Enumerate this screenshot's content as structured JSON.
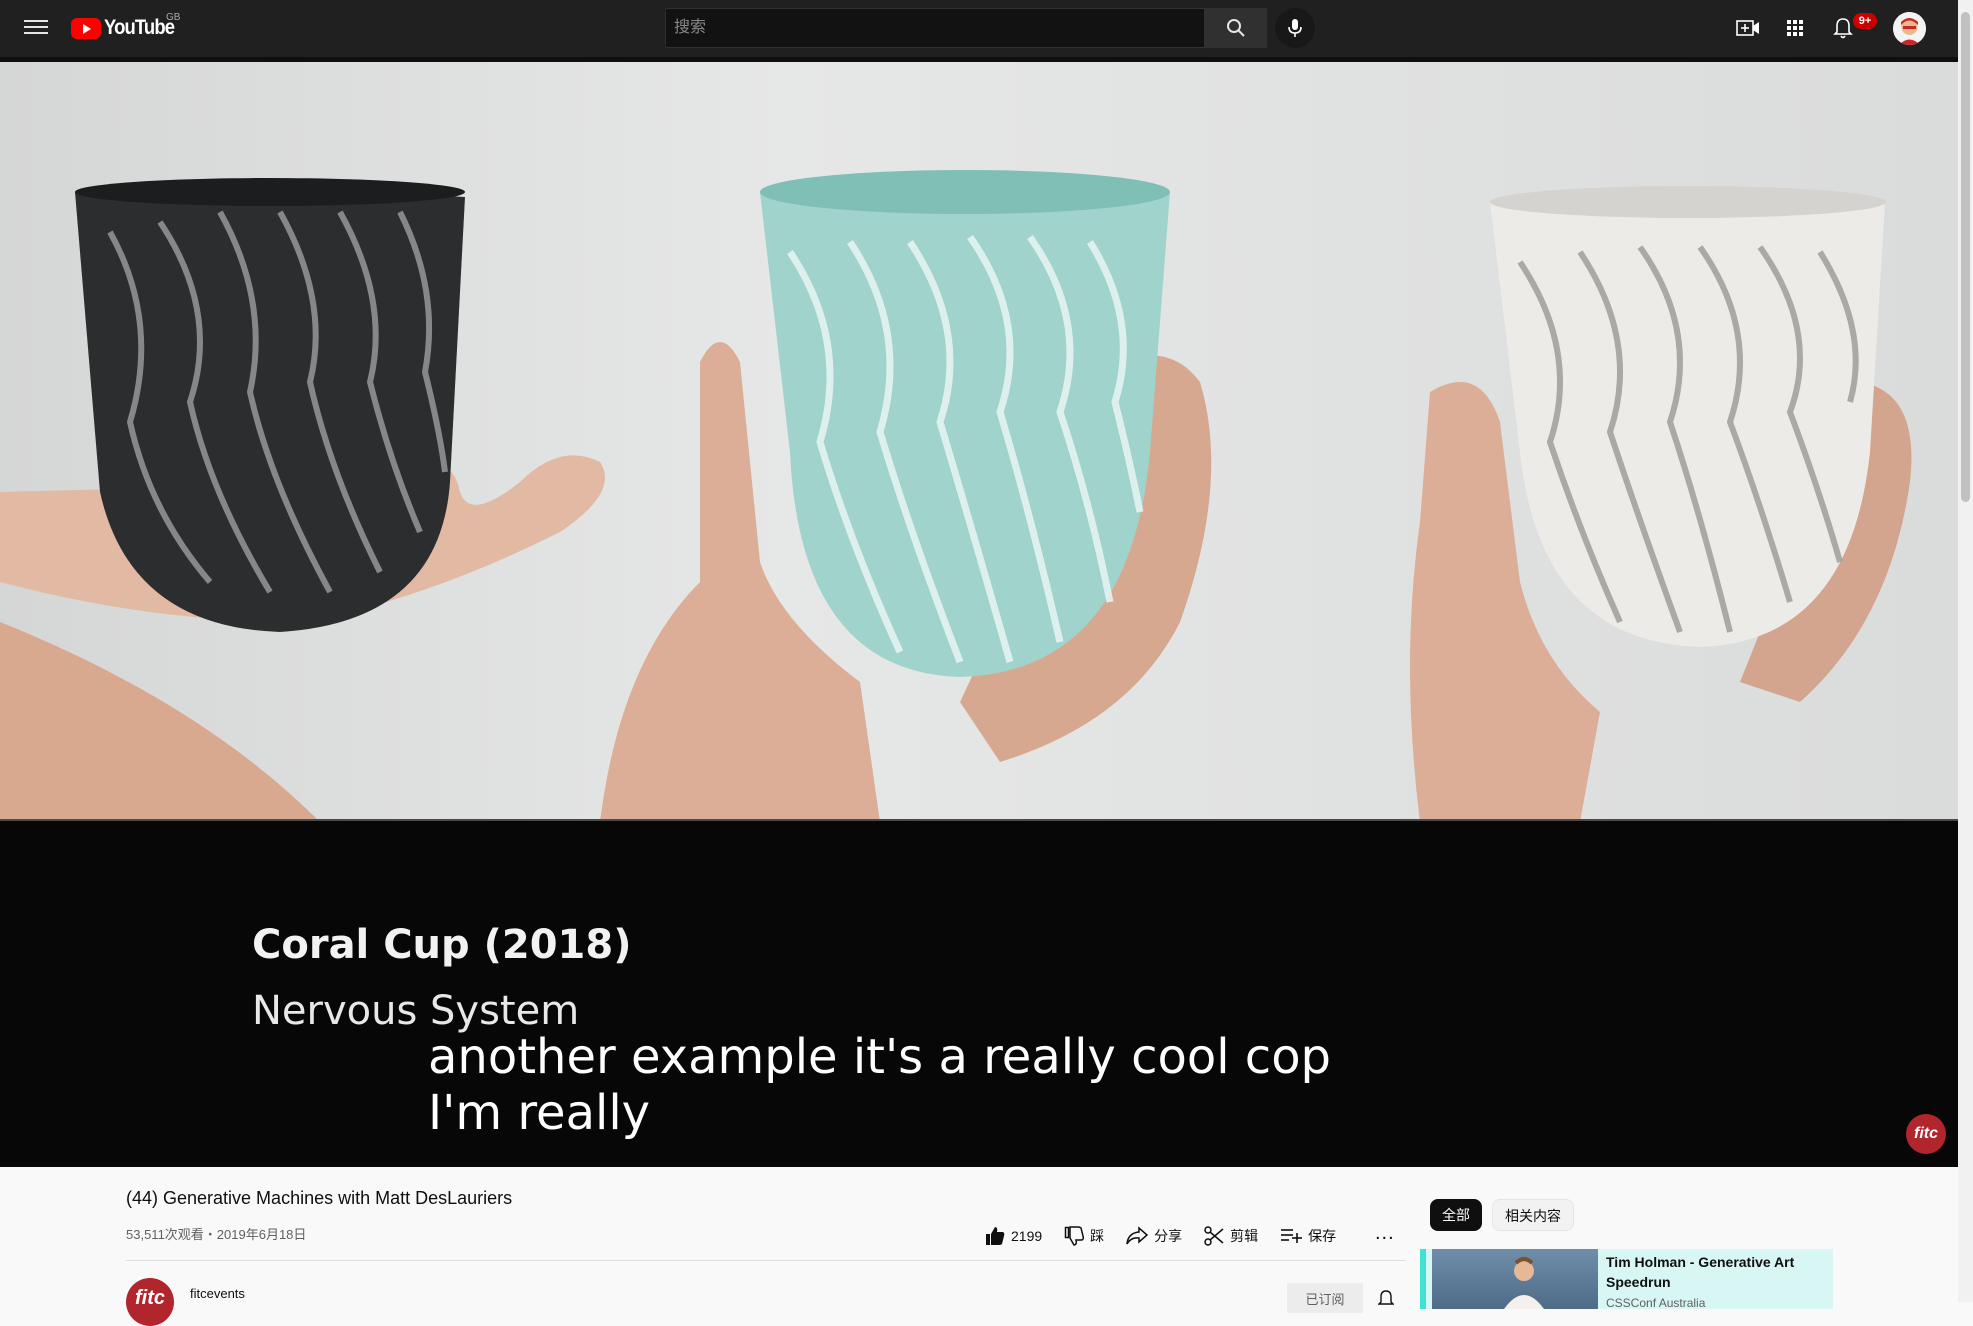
{
  "header": {
    "logo_text": "YouTube",
    "region": "GB",
    "search_placeholder": "搜索",
    "notification_count": "9+"
  },
  "player": {
    "overlay_title": "Coral Cup (2018)",
    "overlay_subtitle": "Nervous System",
    "caption_line1": "another example it's a really cool cop",
    "caption_line2": "I'm really",
    "watermark": "fitc"
  },
  "video": {
    "title": "(44) Generative Machines with Matt DesLauriers",
    "meta": "53,511次观看・2019年6月18日",
    "likes": "2199",
    "dislike_label": "踩",
    "share_label": "分享",
    "clip_label": "剪辑",
    "save_label": "保存",
    "more_label": "..."
  },
  "channel": {
    "name": "fitcevents",
    "avatar_text": "fitc",
    "subscribe_label": "已订阅"
  },
  "sidebar": {
    "chips": [
      "全部",
      "相关内容"
    ],
    "recommendations": [
      {
        "title": "Tim Holman - Generative Art Speedrun",
        "channel": "CSSConf Australia"
      }
    ]
  }
}
